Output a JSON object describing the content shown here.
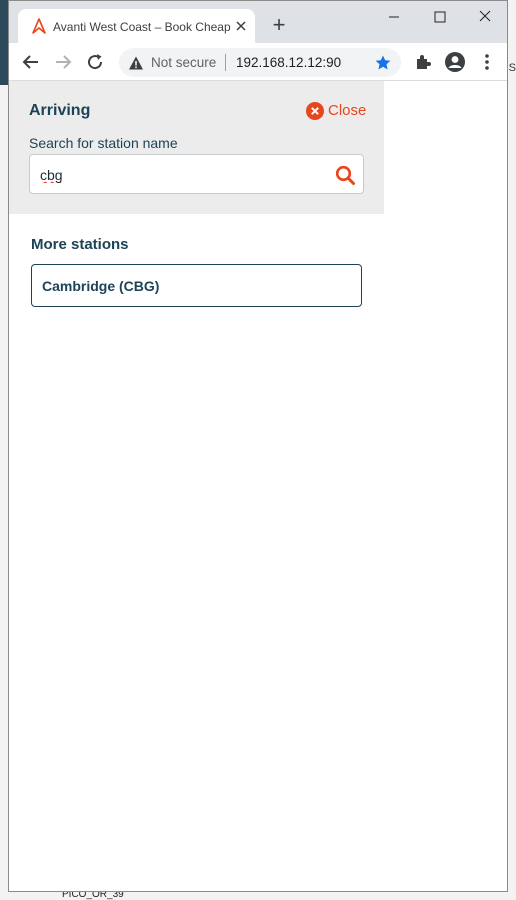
{
  "browser": {
    "tab_title": "Avanti West Coast – Book Cheap",
    "new_tab_symbol": "+",
    "security_text": "Not secure",
    "url": "192.168.12.12:90"
  },
  "panel": {
    "heading": "Arriving",
    "close_label": "Close",
    "search_label": "Search for station name",
    "search_value": "cbg"
  },
  "results": {
    "heading": "More stations",
    "stations": [
      {
        "name": "Cambridge (CBG)"
      }
    ]
  },
  "background": {
    "bottom_text": "PICO_OR_39",
    "right_text": "S"
  },
  "colors": {
    "accent": "#e8461c",
    "brand_navy": "#1d4357",
    "panel_bg": "#ececec",
    "star": "#1a73e8"
  },
  "icons": [
    "avanti-logo-icon",
    "close-x-icon",
    "minimize-icon",
    "maximize-icon",
    "window-close-icon",
    "back-arrow-icon",
    "forward-arrow-icon",
    "reload-icon",
    "warning-icon",
    "star-icon",
    "extensions-icon",
    "profile-icon",
    "menu-kebab-icon",
    "close-circle-icon",
    "search-icon"
  ]
}
